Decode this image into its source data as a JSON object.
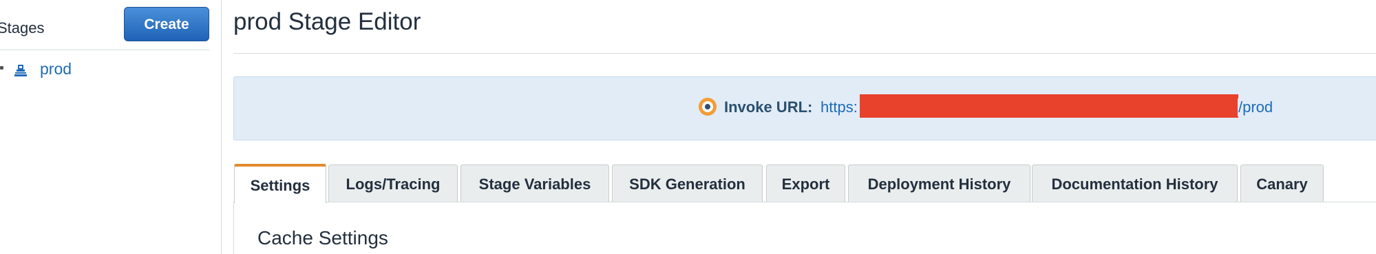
{
  "sidebar": {
    "title": "Stages",
    "create_label": "Create",
    "stages": [
      {
        "label": "prod",
        "icon": "stage-icon"
      }
    ]
  },
  "editor": {
    "title": "prod Stage Editor"
  },
  "invoke": {
    "label": "Invoke URL:",
    "url_prefix": "https:",
    "url_suffix": "/prod",
    "icon": "info-icon"
  },
  "tabs": [
    {
      "label": "Settings",
      "active": true
    },
    {
      "label": "Logs/Tracing",
      "active": false
    },
    {
      "label": "Stage Variables",
      "active": false
    },
    {
      "label": "SDK Generation",
      "active": false
    },
    {
      "label": "Export",
      "active": false
    },
    {
      "label": "Deployment History",
      "active": false
    },
    {
      "label": "Documentation History",
      "active": false
    },
    {
      "label": "Canary",
      "active": false
    }
  ],
  "content": {
    "section_heading": "Cache Settings"
  },
  "colors": {
    "accent_orange": "#e28b2e",
    "link_blue": "#1e6ab8",
    "button_blue": "#1f62b7",
    "banner_bg": "#e1ecf7",
    "redaction_red": "#e8412c"
  }
}
